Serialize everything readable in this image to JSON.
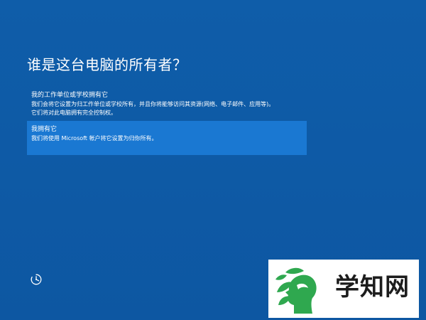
{
  "oobe": {
    "title": "谁是这台电脑的所有者？",
    "options": [
      {
        "title": "我的工作单位或学校拥有它",
        "description_lines": [
          "我们会将它设置为归工作单位或学校所有，并且你将能够访问其资源(网络、电子邮件、应用等)。",
          "它们将对此电脑拥有完全控制权。"
        ],
        "selected": false
      },
      {
        "title": "我拥有它",
        "description_lines": [
          "我们将使用 Microsoft 帐户将它设置为归你所有。"
        ],
        "selected": true
      }
    ]
  },
  "footer": {
    "accessibility_icon": "ease-of-access-icon"
  },
  "watermark": {
    "text": "学知网",
    "logo_icon": "leaf-face-logo"
  },
  "colors": {
    "background": "#0e5aa6",
    "selected_option": "#1a78d2",
    "logo_green": "#2fa84f",
    "watermark_text": "#1c1c1c"
  }
}
